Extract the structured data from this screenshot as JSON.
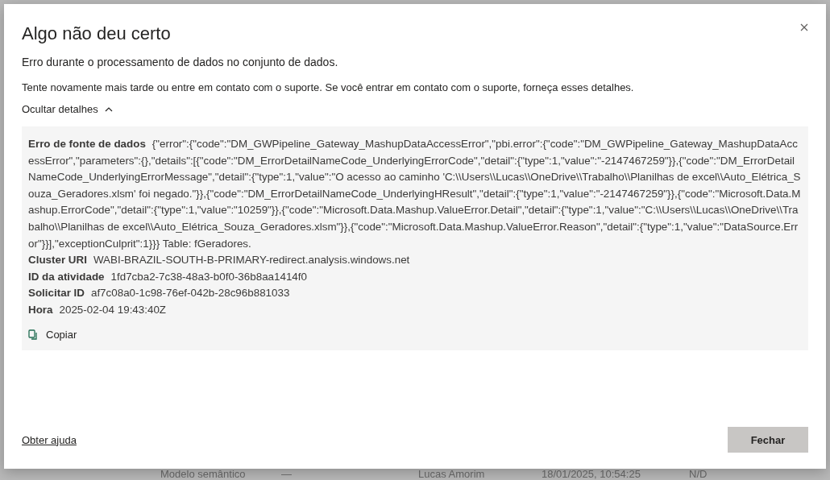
{
  "dialog": {
    "title": "Algo não deu certo",
    "message": "Erro durante o processamento de dados no conjunto de dados.",
    "hint": "Tente novamente mais tarde ou entre em contato com o suporte. Se você entrar em contato com o suporte, forneça esses detalhes.",
    "details_toggle": {
      "label": "Ocultar detalhes",
      "expanded": true
    },
    "details": [
      {
        "label": "Erro de fonte de dados",
        "value": "{\"error\":{\"code\":\"DM_GWPipeline_Gateway_MashupDataAccessError\",\"pbi.error\":{\"code\":\"DM_GWPipeline_Gateway_MashupDataAccessError\",\"parameters\":{},\"details\":[{\"code\":\"DM_ErrorDetailNameCode_UnderlyingErrorCode\",\"detail\":{\"type\":1,\"value\":\"-2147467259\"}},{\"code\":\"DM_ErrorDetailNameCode_UnderlyingErrorMessage\",\"detail\":{\"type\":1,\"value\":\"O acesso ao caminho 'C:\\\\Users\\\\Lucas\\\\OneDrive\\\\Trabalho\\\\Planilhas de excel\\\\Auto_Elétrica_Souza_Geradores.xlsm' foi negado.\"}},{\"code\":\"DM_ErrorDetailNameCode_UnderlyingHResult\",\"detail\":{\"type\":1,\"value\":\"-2147467259\"}},{\"code\":\"Microsoft.Data.Mashup.ErrorCode\",\"detail\":{\"type\":1,\"value\":\"10259\"}},{\"code\":\"Microsoft.Data.Mashup.ValueError.Detail\",\"detail\":{\"type\":1,\"value\":\"C:\\\\Users\\\\Lucas\\\\OneDrive\\\\Trabalho\\\\Planilhas de excel\\\\Auto_Elétrica_Souza_Geradores.xlsm\"}},{\"code\":\"Microsoft.Data.Mashup.ValueError.Reason\",\"detail\":{\"type\":1,\"value\":\"DataSource.Error\"}}],\"exceptionCulprit\":1}}} Table: fGeradores."
      },
      {
        "label": "Cluster URI",
        "value": "WABI-BRAZIL-SOUTH-B-PRIMARY-redirect.analysis.windows.net"
      },
      {
        "label": "ID da atividade",
        "value": "1fd7cba2-7c38-48a3-b0f0-36b8aa1414f0"
      },
      {
        "label": "Solicitar ID",
        "value": "af7c08a0-1c98-76ef-042b-28c96b881033"
      },
      {
        "label": "Hora",
        "value": "2025-02-04 19:43:40Z"
      }
    ],
    "copy_button": "Copiar",
    "help_link": "Obter ajuda",
    "close_button": "Fechar"
  },
  "background_row": [
    "Modelo semântico",
    "—",
    "Lucas Amorim",
    "18/01/2025, 10:54:25",
    "N/D"
  ]
}
